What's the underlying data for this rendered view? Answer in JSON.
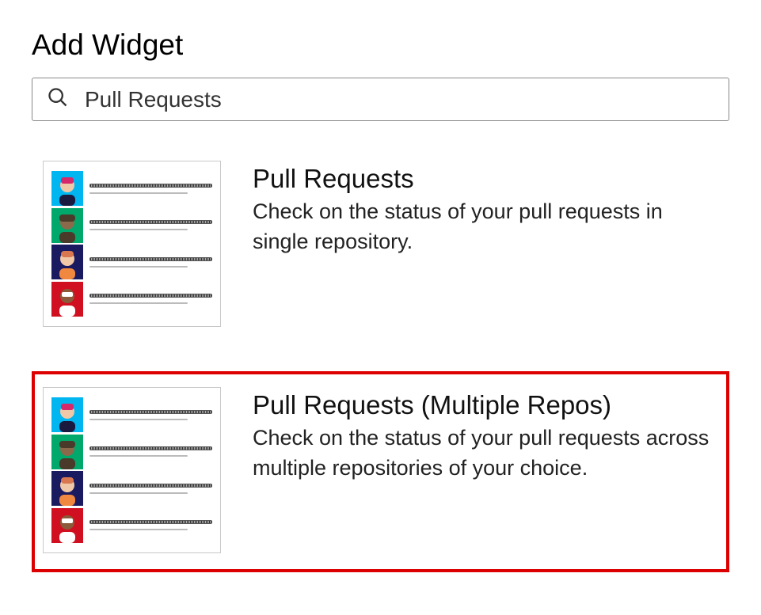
{
  "page": {
    "title": "Add Widget"
  },
  "search": {
    "value": "Pull Requests"
  },
  "widgets": [
    {
      "title": "Pull Requests",
      "description": "Check on the status of your pull requests in single repository.",
      "highlighted": false
    },
    {
      "title": "Pull Requests (Multiple Repos)",
      "description": "Check on the status of your pull requests across multiple repositories of your choice.",
      "highlighted": true
    }
  ]
}
